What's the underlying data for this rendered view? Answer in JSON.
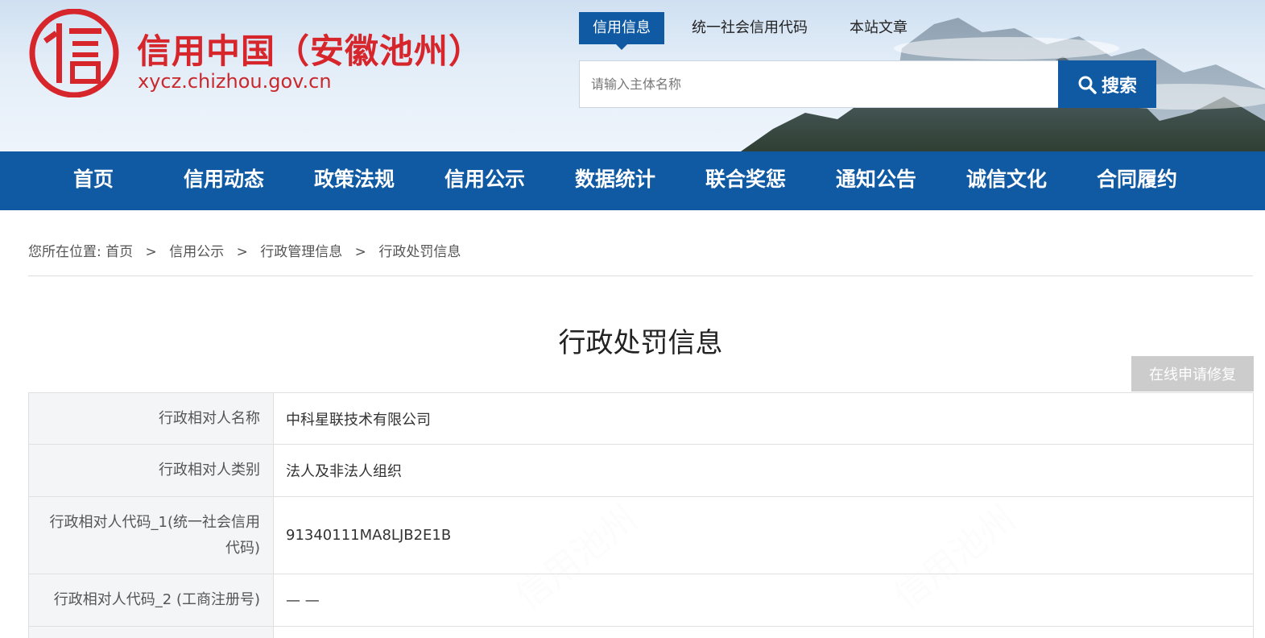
{
  "header": {
    "logo_icon": "xin-seal-logo",
    "site_title": "信用中国（安徽池州）",
    "site_domain": "xycz.chizhou.gov.cn",
    "tabs": [
      {
        "label": "信用信息",
        "active": true
      },
      {
        "label": "统一社会信用代码",
        "active": false
      },
      {
        "label": "本站文章",
        "active": false
      }
    ],
    "search": {
      "placeholder": "请输入主体名称",
      "value": "",
      "button_label": "搜索",
      "button_icon": "search-icon"
    },
    "colors": {
      "brand_red": "#d6262b",
      "brand_blue": "#0f5aa3"
    }
  },
  "nav": {
    "items": [
      {
        "label": "首页"
      },
      {
        "label": "信用动态"
      },
      {
        "label": "政策法规"
      },
      {
        "label": "信用公示"
      },
      {
        "label": "数据统计"
      },
      {
        "label": "联合奖惩"
      },
      {
        "label": "通知公告"
      },
      {
        "label": "诚信文化"
      },
      {
        "label": "合同履约"
      }
    ]
  },
  "breadcrumb": {
    "prefix": "您所在位置:",
    "items": [
      "首页",
      "信用公示",
      "行政管理信息",
      "行政处罚信息"
    ],
    "separator": ">"
  },
  "main": {
    "title": "行政处罚信息",
    "repair_button": "在线申请修复",
    "watermark_text": "信用池州",
    "rows": [
      {
        "label": "行政相对人名称",
        "value": "中科星联技术有限公司"
      },
      {
        "label": "行政相对人类别",
        "value": "法人及非法人组织"
      },
      {
        "label": "行政相对人代码_1(统一社会信用代码)",
        "value": "91340111MA8LJB2E1B"
      },
      {
        "label": "行政相对人代码_2 (工商注册号)",
        "value": "— —"
      }
    ]
  }
}
